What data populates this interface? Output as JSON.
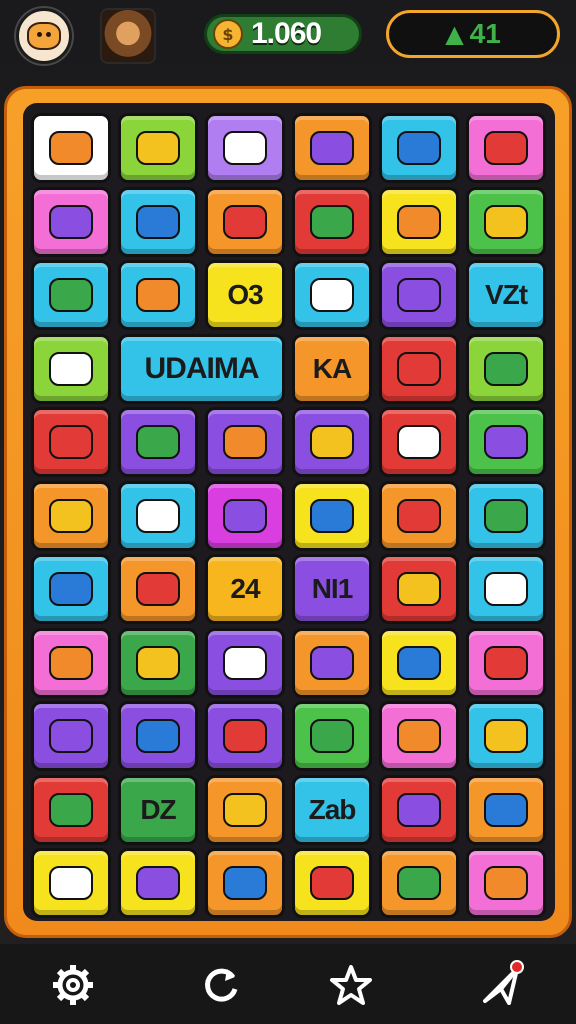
{
  "header": {
    "coins": "1.060",
    "energy": "41",
    "accent_gold": "#f4a62a",
    "accent_green": "#3fb34a"
  },
  "board": {
    "rows": [
      [
        {
          "color": "#ffffff",
          "icon": "orange-fish-icon"
        },
        {
          "color": "#8bd43a",
          "icon": "leaf-icon"
        },
        {
          "color": "#b07ef0",
          "icon": "grape-fruit-icon"
        },
        {
          "color": "#f5962a",
          "icon": "crate-icon"
        },
        {
          "color": "#33c2e8",
          "icon": "green-swirl-icon"
        },
        {
          "color": "#f36fd6",
          "icon": "cart-icon"
        }
      ],
      [
        {
          "color": "#f36fd6",
          "icon": "battery-icon"
        },
        {
          "color": "#33c2e8",
          "icon": "scissors-icon"
        },
        {
          "color": "#f5962a",
          "icon": "eggplant-icon"
        },
        {
          "color": "#e23a36",
          "icon": "fruits-icon"
        },
        {
          "color": "#f7e21e",
          "icon": "monitor-icon"
        },
        {
          "color": "#4cc24a",
          "icon": "cloud-icon"
        }
      ],
      [
        {
          "color": "#33c2e8",
          "icon": "brush-icon"
        },
        {
          "color": "#33c2e8",
          "icon": "bush-icon"
        },
        {
          "color": "#f7e21e",
          "text": "O3"
        },
        {
          "color": "#33c2e8",
          "icon": "tag-icon"
        },
        {
          "color": "#8a4fe0",
          "icon": "pepper-icon"
        },
        {
          "color": "#33c2e8",
          "text": "VZt"
        }
      ],
      [
        {
          "color": "#8bd43a",
          "icon": "wallet-icon"
        },
        {
          "color": "#33c2e8",
          "text": "UDAIMA",
          "span": 2
        },
        {
          "color": "#f5962a",
          "text": "KA"
        },
        {
          "color": "#e23a36",
          "icon": "compass-icon"
        },
        {
          "color": "#8bd43a",
          "icon": "lemons-icon"
        }
      ],
      [
        {
          "color": "#e23a36",
          "icon": "cassette-icon"
        },
        {
          "color": "#8a4fe0",
          "icon": "cheese-icon"
        },
        {
          "color": "#8a4fe0",
          "icon": "radio-icon"
        },
        {
          "color": "#8a4fe0",
          "icon": "berries-icon"
        },
        {
          "color": "#e23a36",
          "icon": "box-icon"
        },
        {
          "color": "#4cc24a",
          "icon": "tomato-icon"
        }
      ],
      [
        {
          "color": "#f5962a",
          "icon": "package-icon"
        },
        {
          "color": "#33c2e8",
          "icon": "paper-plane-icon"
        },
        {
          "color": "#d93ee0",
          "icon": "spool-icon"
        },
        {
          "color": "#f7e21e",
          "icon": "toaster-icon"
        },
        {
          "color": "#f5962a",
          "icon": "pickle-icon"
        },
        {
          "color": "#33c2e8",
          "icon": "camera-icon"
        }
      ],
      [
        {
          "color": "#33c2e8",
          "icon": "truck-icon"
        },
        {
          "color": "#f5962a",
          "icon": "magnifier-icon"
        },
        {
          "color": "#f7b51e",
          "text": "24"
        },
        {
          "color": "#8a4fe0",
          "text": "NI1"
        },
        {
          "color": "#e23a36",
          "icon": "tape-icon"
        },
        {
          "color": "#33c2e8",
          "icon": "bow-icon"
        }
      ],
      [
        {
          "color": "#f36fd6",
          "icon": "flag-icon"
        },
        {
          "color": "#3aa84a",
          "icon": "bundle-icon"
        },
        {
          "color": "#8a4fe0",
          "icon": "caterpillar-icon"
        },
        {
          "color": "#f5962a",
          "icon": "tools-icon"
        },
        {
          "color": "#f7e21e",
          "icon": "whistle-icon"
        },
        {
          "color": "#f36fd6",
          "icon": "speaker-icon"
        }
      ],
      [
        {
          "color": "#8a4fe0",
          "icon": "blob-icon"
        },
        {
          "color": "#8a4fe0",
          "icon": "chick-icon"
        },
        {
          "color": "#8a4fe0",
          "icon": "horn-icon"
        },
        {
          "color": "#4cc24a",
          "icon": "syringe-icon"
        },
        {
          "color": "#f36fd6",
          "icon": "sausage-icon"
        },
        {
          "color": "#33c2e8",
          "icon": "dropper-icon"
        }
      ],
      [
        {
          "color": "#e23a36",
          "icon": "card-icon"
        },
        {
          "color": "#3aa84a",
          "text": "DZ"
        },
        {
          "color": "#f5962a",
          "icon": "cassette-player-icon"
        },
        {
          "color": "#33c2e8",
          "text": "Zab"
        },
        {
          "color": "#e23a36",
          "icon": "screen-icon"
        },
        {
          "color": "#f5962a",
          "icon": "calculator-icon"
        }
      ],
      [
        {
          "color": "#f7e21e",
          "icon": "lollipop-icon"
        },
        {
          "color": "#f7e21e",
          "icon": "balloon-icon"
        },
        {
          "color": "#f5962a",
          "icon": "plum-icon"
        },
        {
          "color": "#f7e21e",
          "icon": "peach-icon"
        },
        {
          "color": "#f5962a",
          "icon": "carrot-icon"
        },
        {
          "color": "#f36fd6",
          "icon": "battery-green-icon"
        }
      ]
    ]
  },
  "nav": [
    {
      "name": "settings-gear-icon"
    },
    {
      "name": "refresh-icon"
    },
    {
      "name": "star-icon"
    },
    {
      "name": "send-icon"
    }
  ]
}
